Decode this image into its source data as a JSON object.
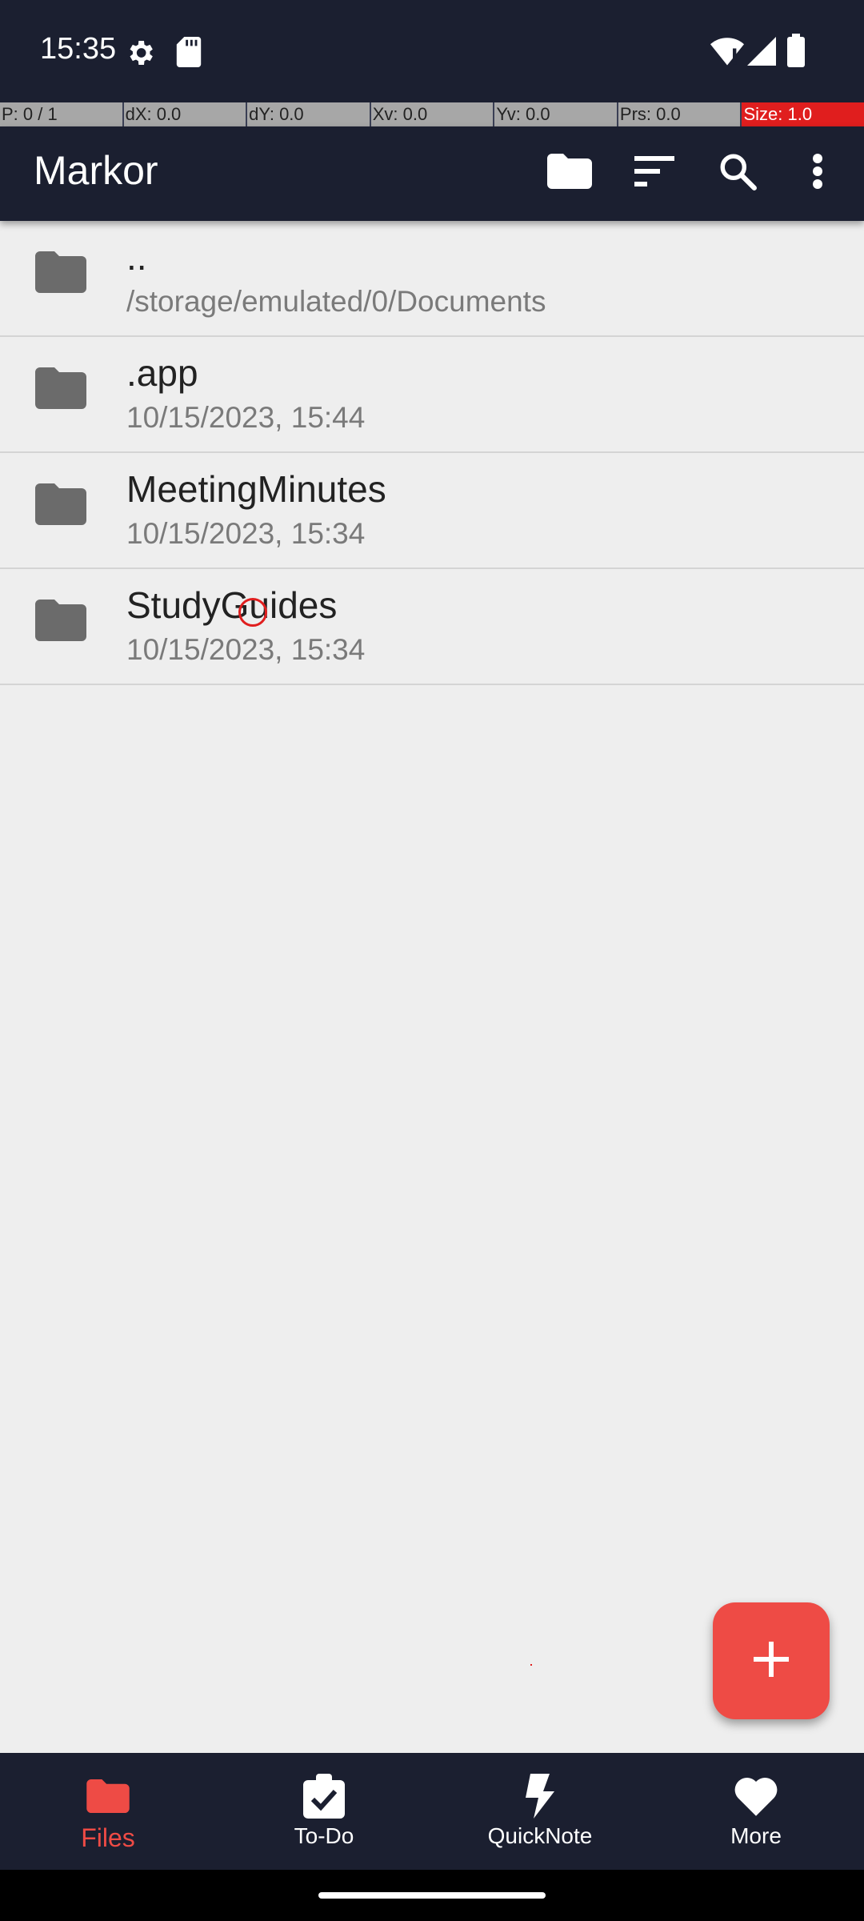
{
  "status_bar": {
    "time": "15:35",
    "icons": [
      "settings-gear-icon",
      "sd-card-icon",
      "wifi-icon",
      "signal-icon",
      "battery-icon"
    ]
  },
  "pointer_info": {
    "cells": [
      "P: 0 / 1",
      "dX: 0.0",
      "dY: 0.0",
      "Xv: 0.0",
      "Yv: 0.0",
      "Prs: 0.0",
      "Size: 1.0"
    ]
  },
  "app_bar": {
    "title": "Markor",
    "actions": [
      "folder-icon",
      "sort-icon",
      "search-icon",
      "more-vert-icon"
    ]
  },
  "files": [
    {
      "name": "..",
      "subtitle": "/storage/emulated/0/Documents",
      "icon": "folder-icon"
    },
    {
      "name": ".app",
      "subtitle": "10/15/2023, 15:44",
      "icon": "folder-icon"
    },
    {
      "name": "MeetingMinutes",
      "subtitle": "10/15/2023, 15:34",
      "icon": "folder-icon"
    },
    {
      "name": "StudyGuides",
      "subtitle": "10/15/2023, 15:34",
      "icon": "folder-icon"
    }
  ],
  "fab": {
    "icon": "plus-icon"
  },
  "bottom_nav": {
    "items": [
      {
        "label": "Files",
        "icon": "folder-icon",
        "active": true
      },
      {
        "label": "To-Do",
        "icon": "checklist-icon",
        "active": false
      },
      {
        "label": "QuickNote",
        "icon": "bolt-icon",
        "active": false
      },
      {
        "label": "More",
        "icon": "heart-icon",
        "active": false
      }
    ]
  },
  "colors": {
    "app_bar_bg": "#1b1f30",
    "accent": "#ee4b45",
    "list_bg": "#eeeeee",
    "folder_icon": "#6b6b6b"
  }
}
